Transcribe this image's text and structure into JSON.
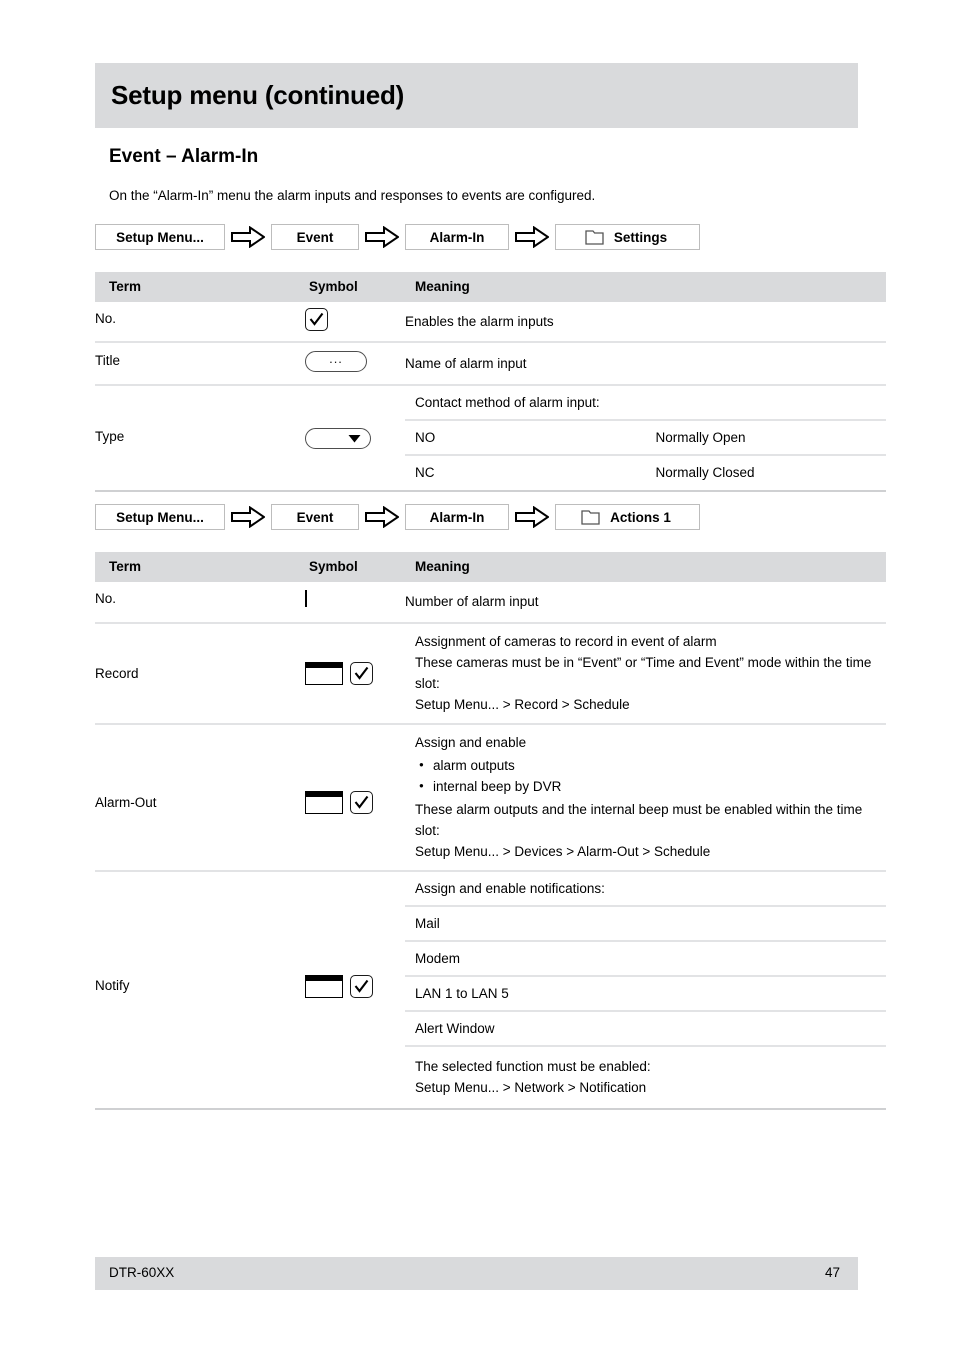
{
  "page": {
    "chapter_title": "Setup menu (continued)",
    "section_title": "Event – Alarm-In",
    "intro": "On the “Alarm-In” menu the alarm inputs and responses to events are configured."
  },
  "breadcrumb_settings": {
    "items": [
      "Setup Menu...",
      "Event",
      "Alarm-In",
      "Settings"
    ],
    "separator_icon": "right-block-arrow-icon",
    "leaf_icon": "folder-icon"
  },
  "breadcrumb_actions": {
    "items": [
      "Setup Menu...",
      "Event",
      "Alarm-In",
      "Actions 1"
    ],
    "separator_icon": "right-block-arrow-icon",
    "leaf_icon": "folder-icon"
  },
  "table_settings": {
    "headers": [
      "Term",
      "Symbol",
      "Meaning"
    ],
    "rows": [
      {
        "term": "No.",
        "symbol": "checkbox-checked-icon",
        "meaning": "Enables the alarm inputs"
      },
      {
        "term": "Title",
        "symbol": "ellipsis-button-icon",
        "symbol_label": "...",
        "meaning": "Name of alarm input"
      },
      {
        "term": "Type",
        "symbol": "dropdown-icon",
        "meaning_intro": "Contact method of alarm input:",
        "options": [
          {
            "code": "NO",
            "text": "Normally Open"
          },
          {
            "code": "NC",
            "text": "Normally Closed"
          }
        ]
      }
    ]
  },
  "table_actions": {
    "headers": [
      "Term",
      "Symbol",
      "Meaning"
    ],
    "rows": [
      {
        "term": "No.",
        "symbol": "plain-box-icon",
        "meaning": "Number of alarm input"
      },
      {
        "term": "Record",
        "symbol_a": "list-box-icon",
        "symbol_b": "checkbox-checked-icon",
        "lines": [
          "Assignment of cameras to record in event of alarm",
          "These cameras must be in “Event” or “Time and Event” mode within the time slot:",
          "Setup Menu... > Record > Schedule"
        ]
      },
      {
        "term": "Alarm-Out",
        "symbol_a": "list-box-icon",
        "symbol_b": "checkbox-checked-icon",
        "intro": "Assign and enable",
        "bullets": [
          "alarm outputs",
          "internal beep by DVR"
        ],
        "lines": [
          "These alarm outputs and the internal beep must be enabled within the time slot:",
          "Setup Menu... > Devices > Alarm-Out > Schedule"
        ]
      },
      {
        "term": "Notify",
        "symbol_a": "list-box-icon",
        "symbol_b": "checkbox-checked-icon",
        "meaning_intro": "Assign and enable notifications:",
        "options": [
          "Mail",
          "Modem",
          "LAN 1 to LAN 5",
          "Alert Window"
        ],
        "footer_lines": [
          "The selected function must be enabled:",
          "Setup Menu... > Network > Notification"
        ]
      }
    ]
  },
  "footer": {
    "model": "DTR-60XX",
    "page_number": "47"
  }
}
